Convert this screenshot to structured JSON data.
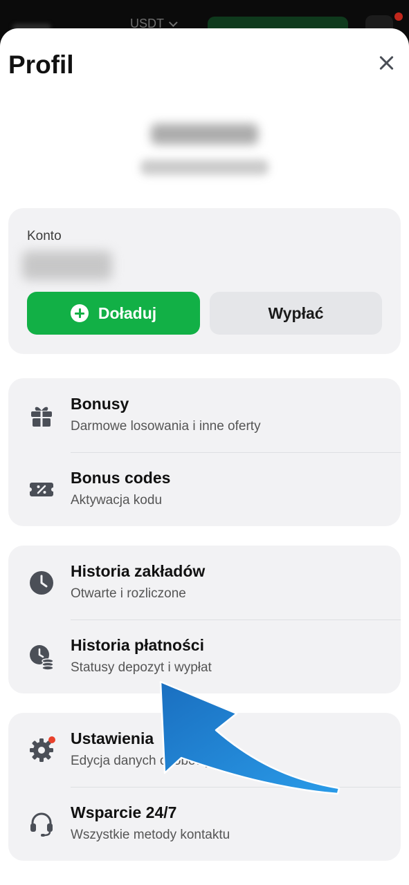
{
  "topbar": {
    "currency": "USDT"
  },
  "profile": {
    "title": "Profil"
  },
  "balance": {
    "label": "Konto",
    "topup_label": "Doładuj",
    "withdraw_label": "Wypłać"
  },
  "menu": {
    "group1": [
      {
        "label": "Bonusy",
        "sub": "Darmowe losowania i inne oferty",
        "icon": "gift-icon"
      },
      {
        "label": "Bonus codes",
        "sub": "Aktywacja kodu",
        "icon": "coupon-icon"
      }
    ],
    "group2": [
      {
        "label": "Historia zakładów",
        "sub": "Otwarte i rozliczone",
        "icon": "clock-icon"
      },
      {
        "label": "Historia płatności",
        "sub": "Statusy depozyt i wypłat",
        "icon": "payment-history-icon"
      }
    ],
    "group3": [
      {
        "label": "Ustawienia",
        "sub": "Edycja danych osobowych",
        "icon": "gear-icon"
      },
      {
        "label": "Wsparcie 24/7",
        "sub": "Wszystkie metody kontaktu",
        "icon": "headset-icon"
      }
    ]
  },
  "colors": {
    "accent_green": "#12b046",
    "notification_dot": "#e8412b",
    "annotation_arrow": "#1f86d6"
  }
}
